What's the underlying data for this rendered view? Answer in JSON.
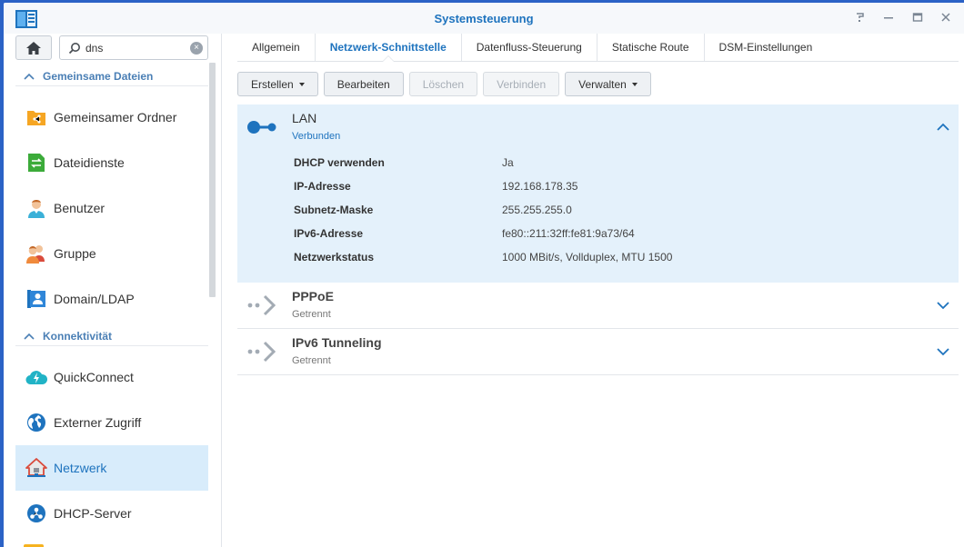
{
  "window": {
    "title": "Systemsteuerung"
  },
  "search": {
    "value": "dns"
  },
  "sidebar": {
    "sections": [
      {
        "label": "Gemeinsame Dateien"
      },
      {
        "label": "Konnektivität"
      }
    ],
    "items": [
      {
        "label": "Gemeinsamer Ordner",
        "icon": "shared-folder-icon"
      },
      {
        "label": "Dateidienste",
        "icon": "file-services-icon"
      },
      {
        "label": "Benutzer",
        "icon": "user-icon"
      },
      {
        "label": "Gruppe",
        "icon": "group-icon"
      },
      {
        "label": "Domain/LDAP",
        "icon": "domain-ldap-icon"
      },
      {
        "label": "QuickConnect",
        "icon": "quickconnect-icon"
      },
      {
        "label": "Externer Zugriff",
        "icon": "external-access-icon"
      },
      {
        "label": "Netzwerk",
        "icon": "network-icon",
        "active": true
      },
      {
        "label": "DHCP-Server",
        "icon": "dhcp-server-icon"
      }
    ]
  },
  "tabs": [
    {
      "label": "Allgemein"
    },
    {
      "label": "Netzwerk-Schnittstelle",
      "active": true
    },
    {
      "label": "Datenfluss-Steuerung"
    },
    {
      "label": "Statische Route"
    },
    {
      "label": "DSM-Einstellungen"
    }
  ],
  "toolbar": {
    "create": "Erstellen",
    "edit": "Bearbeiten",
    "delete": "Löschen",
    "connect": "Verbinden",
    "manage": "Verwalten"
  },
  "interfaces": [
    {
      "name": "LAN",
      "status": "Verbunden",
      "expanded": true,
      "details": [
        {
          "label": "DHCP verwenden",
          "value": "Ja"
        },
        {
          "label": "IP-Adresse",
          "value": "192.168.178.35"
        },
        {
          "label": "Subnetz-Maske",
          "value": "255.255.255.0"
        },
        {
          "label": "IPv6-Adresse",
          "value": "fe80::211:32ff:fe81:9a73/64"
        },
        {
          "label": "Netzwerkstatus",
          "value": "1000 MBit/s, Vollduplex, MTU 1500"
        }
      ]
    },
    {
      "name": "PPPoE",
      "status": "Getrennt",
      "expanded": false
    },
    {
      "name": "IPv6 Tunneling",
      "status": "Getrennt",
      "expanded": false
    }
  ],
  "colors": {
    "accent": "#1e73be",
    "active_bg": "#d8ecfb",
    "expanded_bg": "#e4f1fb",
    "desktop": "#2b62c6"
  }
}
